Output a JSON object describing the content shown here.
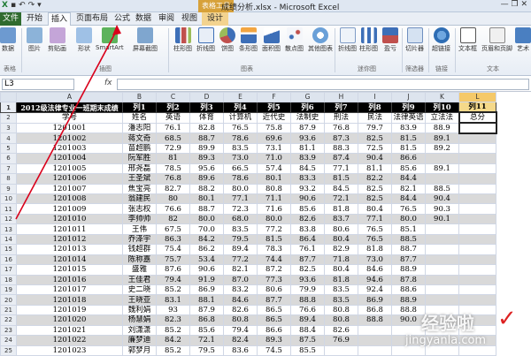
{
  "window": {
    "title": "成绩分析.xlsx - Microsoft Excel",
    "context_tab_group": "表格工具"
  },
  "tabs": [
    "文件",
    "开始",
    "插入",
    "页面布局",
    "公式",
    "数据",
    "审阅",
    "视图",
    "设计"
  ],
  "ribbon": {
    "buttons": [
      "数据",
      "图片",
      "剪贴画",
      "形状",
      "SmartArt",
      "屏幕截图",
      "柱形图",
      "折线图",
      "饼图",
      "条形图",
      "面积图",
      "散点图",
      "其他图表",
      "折线图",
      "柱形图",
      "盈亏",
      "切片器",
      "超链接",
      "文本框",
      "页眉和页脚",
      "艺术"
    ],
    "groups": [
      "表格",
      "插图",
      "图表",
      "迷你图",
      "筛选器",
      "链接",
      "文本"
    ]
  },
  "formula_bar": {
    "cell_ref": "L3",
    "fx": "fx",
    "value": ""
  },
  "columns": [
    "A",
    "B",
    "C",
    "D",
    "E",
    "F",
    "G",
    "H",
    "I",
    "J",
    "K",
    "L"
  ],
  "header_row": [
    "2012级法律专业一班期末成绩",
    "列1",
    "列2",
    "列3",
    "列4",
    "列5",
    "列6",
    "列7",
    "列8",
    "列9",
    "列10",
    "列11"
  ],
  "subheader_row": [
    "学号",
    "姓名",
    "英语",
    "体育",
    "计算机",
    "近代史",
    "法制史",
    "刑法",
    "民法",
    "法律英语",
    "立法法",
    "总分"
  ],
  "rows": [
    {
      "n": "3",
      "cells": [
        "1201001",
        "潘志阳",
        "76.1",
        "82.8",
        "76.5",
        "75.8",
        "87.9",
        "76.8",
        "79.7",
        "83.9",
        "88.9",
        ""
      ]
    },
    {
      "n": "4",
      "cells": [
        "1201002",
        "蒋文奇",
        "68.5",
        "88.7",
        "78.6",
        "69.6",
        "93.6",
        "87.3",
        "82.5",
        "81.5",
        "89.1",
        ""
      ]
    },
    {
      "n": "5",
      "cells": [
        "1201003",
        "苗超鹏",
        "72.9",
        "89.9",
        "83.5",
        "73.1",
        "81.1",
        "88.3",
        "72.5",
        "81.5",
        "89.2",
        ""
      ]
    },
    {
      "n": "6",
      "cells": [
        "1201004",
        "阮军胜",
        "81",
        "89.3",
        "73.0",
        "71.0",
        "83.9",
        "87.4",
        "90.4",
        "86.6",
        ""
      ]
    },
    {
      "n": "7",
      "cells": [
        "1201005",
        "邢尧磊",
        "78.5",
        "95.6",
        "66.5",
        "57.4",
        "84.5",
        "77.1",
        "81.1",
        "85.6",
        "89.1",
        ""
      ]
    },
    {
      "n": "8",
      "cells": [
        "1201006",
        "王圣斌",
        "76.8",
        "89.6",
        "78.6",
        "80.1",
        "83.3",
        "81.5",
        "82.2",
        "84.4",
        "",
        ""
      ]
    },
    {
      "n": "9",
      "cells": [
        "1201007",
        "焦宝亮",
        "82.7",
        "88.2",
        "80.0",
        "80.8",
        "93.2",
        "84.5",
        "82.5",
        "82.1",
        "88.5",
        ""
      ]
    },
    {
      "n": "10",
      "cells": [
        "1201008",
        "翁建民",
        "80",
        "80.1",
        "77.1",
        "71.1",
        "90.6",
        "72.1",
        "82.5",
        "84.4",
        "90.4",
        ""
      ]
    },
    {
      "n": "11",
      "cells": [
        "1201009",
        "张志权",
        "76.6",
        "88.7",
        "72.3",
        "71.6",
        "85.6",
        "81.8",
        "80.4",
        "76.5",
        "90.3",
        ""
      ]
    },
    {
      "n": "12",
      "cells": [
        "1201010",
        "李帅帅",
        "82",
        "80.0",
        "68.0",
        "80.0",
        "82.6",
        "83.7",
        "77.1",
        "80.0",
        "90.1",
        ""
      ]
    },
    {
      "n": "13",
      "cells": [
        "1201011",
        "王伟",
        "67.5",
        "70.0",
        "83.5",
        "77.2",
        "83.8",
        "80.6",
        "76.5",
        "85.1",
        ""
      ]
    },
    {
      "n": "14",
      "cells": [
        "1201012",
        "乔泽宇",
        "86.3",
        "84.2",
        "79.5",
        "81.5",
        "86.4",
        "80.4",
        "76.5",
        "88.5",
        ""
      ]
    },
    {
      "n": "15",
      "cells": [
        "1201013",
        "钱超群",
        "75.4",
        "86.2",
        "89.4",
        "78.3",
        "76.1",
        "82.9",
        "81.8",
        "88.7",
        ""
      ]
    },
    {
      "n": "16",
      "cells": [
        "1201014",
        "陈称嘉",
        "75.7",
        "53.4",
        "77.2",
        "74.4",
        "87.7",
        "71.8",
        "73.0",
        "87.7",
        ""
      ]
    },
    {
      "n": "17",
      "cells": [
        "1201015",
        "盛雅",
        "87.6",
        "90.6",
        "82.1",
        "87.2",
        "82.5",
        "80.4",
        "84.6",
        "88.9",
        ""
      ]
    },
    {
      "n": "18",
      "cells": [
        "1201016",
        "王佳君",
        "79.4",
        "91.9",
        "87.0",
        "77.3",
        "93.6",
        "81.8",
        "94.6",
        "87.8",
        ""
      ]
    },
    {
      "n": "19",
      "cells": [
        "1201017",
        "史二晓",
        "85.2",
        "86.9",
        "83.2",
        "80.6",
        "79.9",
        "83.5",
        "92.4",
        "88.6",
        ""
      ]
    },
    {
      "n": "20",
      "cells": [
        "1201018",
        "王晓亚",
        "83.1",
        "88.1",
        "84.6",
        "87.7",
        "88.8",
        "83.5",
        "86.9",
        "88.9",
        ""
      ]
    },
    {
      "n": "21",
      "cells": [
        "1201019",
        "魏利娟",
        "93",
        "87.9",
        "82.6",
        "86.5",
        "76.6",
        "80.8",
        "86.8",
        "88.8",
        ""
      ]
    },
    {
      "n": "22",
      "cells": [
        "1201020",
        "杨慧娟",
        "82.3",
        "86.8",
        "80.8",
        "86.5",
        "89.4",
        "80.8",
        "88.8",
        "90.0",
        ""
      ]
    },
    {
      "n": "23",
      "cells": [
        "1201021",
        "刘潇潇",
        "85.2",
        "85.6",
        "79.4",
        "86.6",
        "88.4",
        "82.6",
        "",
        ""
      ]
    },
    {
      "n": "24",
      "cells": [
        "1201022",
        "廉梦迪",
        "84.2",
        "72.1",
        "82.4",
        "89.3",
        "87.5",
        "76.9",
        "",
        ""
      ]
    },
    {
      "n": "25",
      "cells": [
        "1201023",
        "郭梦月",
        "85.2",
        "79.5",
        "83.6",
        "74.5",
        "85.5",
        "",
        ""
      ]
    }
  ],
  "watermark": {
    "cn": "经验啦",
    "url": "jingyanla.com"
  }
}
